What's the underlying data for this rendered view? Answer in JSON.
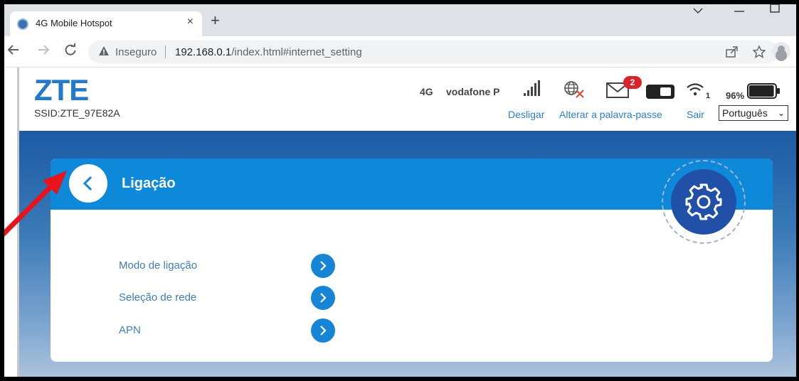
{
  "browser": {
    "tab_title": "4G Mobile Hotspot",
    "tab_close": "×",
    "new_tab": "+",
    "insecure_label": "Inseguro",
    "url_host": "192.168.0.1",
    "url_path": "/index.html#internet_setting"
  },
  "header": {
    "logo": "ZTE",
    "ssid": "SSID:ZTE_97E82A",
    "network_type": "4G",
    "operator": "vodafone P",
    "sms_count": "2",
    "wifi_clients": "1",
    "battery_percent": "96%",
    "battery_level": 0.96,
    "links": {
      "disconnect": "Desligar",
      "change_password": "Alterar a palavra-passe",
      "logout": "Sair"
    },
    "language_selected": "Português"
  },
  "card": {
    "title": "Ligação",
    "items": [
      {
        "label": "Modo de ligação"
      },
      {
        "label": "Seleção de rede"
      },
      {
        "label": "APN"
      }
    ]
  },
  "colors": {
    "brand_blue": "#2479c8",
    "header_blue": "#0e88d8",
    "badge_red": "#d9232a",
    "annotation_arrow": "#e8141c"
  }
}
